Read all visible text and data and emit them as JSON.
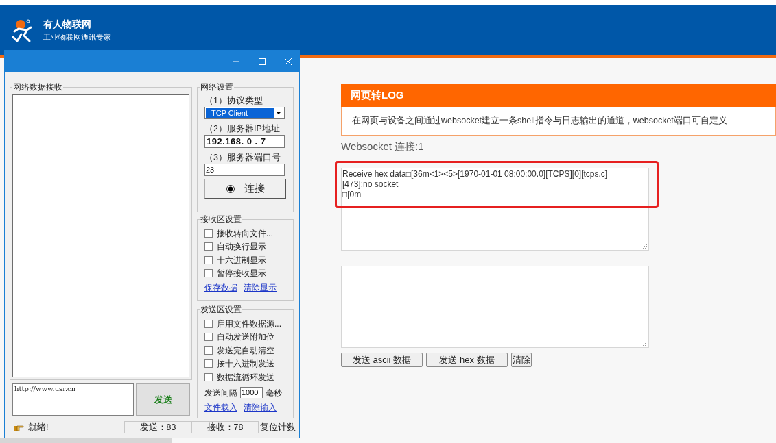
{
  "header": {
    "brand": "有人物联网",
    "slogan": "工业物联网通讯专家"
  },
  "log_panel": {
    "title": "网页转LOG",
    "description": "在网页与设备之间通过websocket建立一条shell指令与日志输出的通道，websocket端口可自定义",
    "connection": "Websocket 连接:1",
    "log_lines": [
      "Receive hex data□[36m<1><5>[1970-01-01 08:00:00.0][TCPS][0][tcps.c]",
      "[473]:no socket",
      "□[0m"
    ],
    "highlighted": true,
    "buttons": [
      "发送 ascii 数据",
      "发送 hex 数据",
      "清除"
    ]
  },
  "app_window": {
    "receive_group": {
      "title": "网络数据接收"
    },
    "network_settings": {
      "title": "网络设置",
      "protocol_label": "（1）协议类型",
      "protocol_value": "TCP Client",
      "ip_label": "（2）服务器IP地址",
      "ip_value": "192.168. 0 . 7",
      "port_label": "（3）服务器端口号",
      "port_value": "23",
      "connect_button": "连接"
    },
    "receive_settings": {
      "title": "接收区设置",
      "options": [
        {
          "label": "接收转向文件...",
          "checked": false
        },
        {
          "label": "自动换行显示",
          "checked": false
        },
        {
          "label": "十六进制显示",
          "checked": false
        },
        {
          "label": "暂停接收显示",
          "checked": false
        }
      ],
      "links": [
        "保存数据",
        "清除显示"
      ]
    },
    "send_settings": {
      "title": "发送区设置",
      "options": [
        {
          "label": "启用文件数据源...",
          "checked": false
        },
        {
          "label": "自动发送附加位",
          "checked": false
        },
        {
          "label": "发送完自动清空",
          "checked": false
        },
        {
          "label": "按十六进制发送",
          "checked": false
        },
        {
          "label": "数据流循环发送",
          "checked": false
        }
      ],
      "interval_label": "发送间隔",
      "interval_value": "1000",
      "interval_unit": "毫秒",
      "links": [
        "文件载入",
        "清除输入"
      ]
    },
    "send_text": "http://www.usr.cn",
    "send_button": "发送",
    "status_bar": {
      "status": "就绪!",
      "sent": "发送：83",
      "received": "接收：78",
      "reset": "复位计数"
    }
  }
}
